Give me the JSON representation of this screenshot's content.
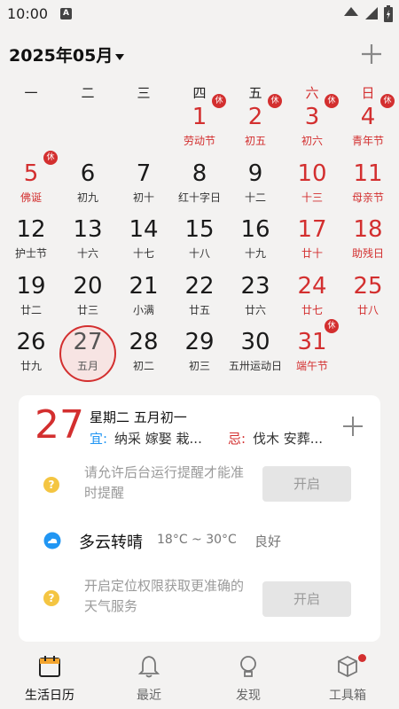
{
  "status": {
    "time": "10:00",
    "a_icon": "A"
  },
  "header": {
    "title": "2025年05月",
    "dropdown_icon": "triangle-down-icon"
  },
  "weekdays": [
    "一",
    "二",
    "三",
    "四",
    "五",
    "六",
    "日"
  ],
  "calendar": [
    {
      "day": "1",
      "sub": "劳动节",
      "badge": "休",
      "red": true,
      "sub_red": true
    },
    {
      "day": "2",
      "sub": "初五",
      "badge": "休",
      "red": true,
      "sub_red": false
    },
    {
      "day": "3",
      "sub": "初六",
      "badge": "休",
      "red": true,
      "sub_red": false
    },
    {
      "day": "4",
      "sub": "青年节",
      "badge": "休",
      "red": true,
      "sub_red": true
    },
    {
      "day": "5",
      "sub": "佛诞",
      "badge": "休",
      "red": true,
      "sub_red": true
    },
    {
      "day": "6",
      "sub": "初九",
      "badge": "",
      "red": false,
      "sub_red": false
    },
    {
      "day": "7",
      "sub": "初十",
      "badge": "",
      "red": false,
      "sub_red": false
    },
    {
      "day": "8",
      "sub": "红十字日",
      "badge": "",
      "red": false,
      "sub_red": false
    },
    {
      "day": "9",
      "sub": "十二",
      "badge": "",
      "red": false,
      "sub_red": false
    },
    {
      "day": "10",
      "sub": "十三",
      "badge": "",
      "red": true,
      "sub_red": false
    },
    {
      "day": "11",
      "sub": "母亲节",
      "badge": "",
      "red": true,
      "sub_red": true
    },
    {
      "day": "12",
      "sub": "护士节",
      "badge": "",
      "red": false,
      "sub_red": false
    },
    {
      "day": "13",
      "sub": "十六",
      "badge": "",
      "red": false,
      "sub_red": false
    },
    {
      "day": "14",
      "sub": "十七",
      "badge": "",
      "red": false,
      "sub_red": false
    },
    {
      "day": "15",
      "sub": "十八",
      "badge": "",
      "red": false,
      "sub_red": false
    },
    {
      "day": "16",
      "sub": "十九",
      "badge": "",
      "red": false,
      "sub_red": false
    },
    {
      "day": "17",
      "sub": "廿十",
      "badge": "",
      "red": true,
      "sub_red": false
    },
    {
      "day": "18",
      "sub": "助残日",
      "badge": "",
      "red": true,
      "sub_red": true
    },
    {
      "day": "19",
      "sub": "廿二",
      "badge": "",
      "red": false,
      "sub_red": false
    },
    {
      "day": "20",
      "sub": "廿三",
      "badge": "",
      "red": false,
      "sub_red": false
    },
    {
      "day": "21",
      "sub": "小满",
      "badge": "",
      "red": false,
      "sub_red": false
    },
    {
      "day": "22",
      "sub": "廿五",
      "badge": "",
      "red": false,
      "sub_red": false
    },
    {
      "day": "23",
      "sub": "廿六",
      "badge": "",
      "red": false,
      "sub_red": false
    },
    {
      "day": "24",
      "sub": "廿七",
      "badge": "",
      "red": true,
      "sub_red": false
    },
    {
      "day": "25",
      "sub": "廿八",
      "badge": "",
      "red": true,
      "sub_red": false
    },
    {
      "day": "26",
      "sub": "廿九",
      "badge": "",
      "red": false,
      "sub_red": false
    },
    {
      "day": "27",
      "sub": "五月",
      "badge": "",
      "red": false,
      "sub_red": false,
      "today": true
    },
    {
      "day": "28",
      "sub": "初二",
      "badge": "",
      "red": false,
      "sub_red": false
    },
    {
      "day": "29",
      "sub": "初三",
      "badge": "",
      "red": false,
      "sub_red": false
    },
    {
      "day": "30",
      "sub": "五卅运动日",
      "badge": "",
      "red": false,
      "sub_red": false
    },
    {
      "day": "31",
      "sub": "端午节",
      "badge": "休",
      "red": true,
      "sub_red": true
    }
  ],
  "detail": {
    "day": "27",
    "weekday_lunar": "星期二 五月初一",
    "yi_label": "宜:",
    "yi_text": "纳采 嫁娶 栽...",
    "ji_label": "忌:",
    "ji_text": "伐木 安葬..."
  },
  "reminder": {
    "hint": "请允许后台运行提醒才能准时提醒",
    "button": "开启",
    "icon": "question-icon"
  },
  "weather": {
    "desc": "多云转晴",
    "temp": "18°C ~ 30°C",
    "aqi": "良好",
    "icon": "cloud-sun-icon"
  },
  "location": {
    "hint": "开启定位权限获取更准确的天气服务",
    "button": "开启",
    "icon": "question-icon"
  },
  "nav": [
    {
      "label": "生活日历",
      "icon": "calendar-icon",
      "active": true
    },
    {
      "label": "最近",
      "icon": "bell-icon",
      "active": false
    },
    {
      "label": "发现",
      "icon": "lightbulb-icon",
      "active": false
    },
    {
      "label": "工具箱",
      "icon": "box-icon",
      "active": false
    }
  ],
  "colors": {
    "accent_red": "#d32f2f",
    "accent_blue": "#2196f3"
  }
}
